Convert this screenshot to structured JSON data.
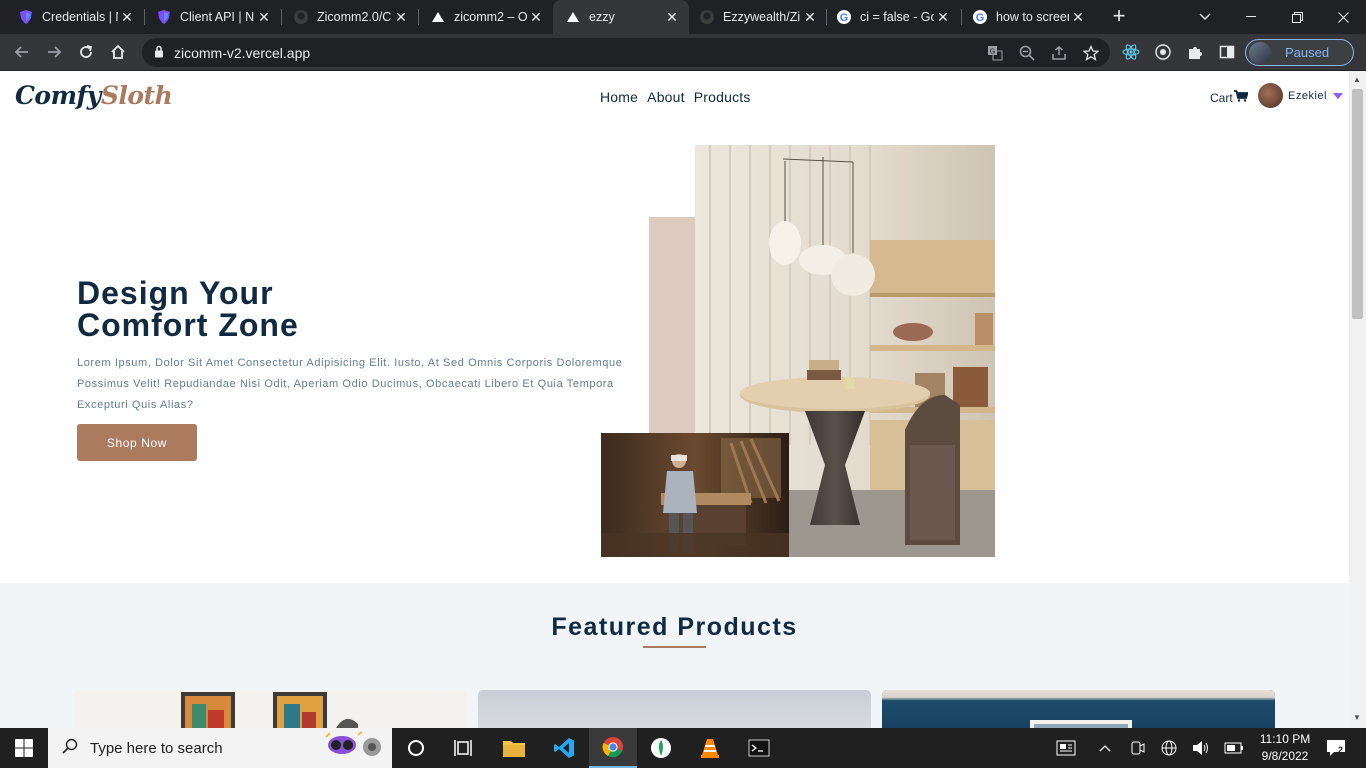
{
  "browser": {
    "tabs": [
      {
        "title": "Credentials | N",
        "icon": "shield-icon",
        "active": false
      },
      {
        "title": "Client API | N",
        "icon": "shield-icon",
        "active": false
      },
      {
        "title": "Zicomm2.0/C",
        "icon": "github-icon",
        "active": false
      },
      {
        "title": "zicomm2 – O",
        "icon": "vercel-icon",
        "active": false
      },
      {
        "title": "ezzy",
        "icon": "vercel-icon",
        "active": true
      },
      {
        "title": "Ezzywealth/Zi",
        "icon": "github-icon",
        "active": false
      },
      {
        "title": "ci = false - Go",
        "icon": "google-icon",
        "active": false
      },
      {
        "title": "how to screen",
        "icon": "google-icon",
        "active": false
      }
    ],
    "url": "zicomm-v2.vercel.app",
    "profile_status": "Paused"
  },
  "site": {
    "logo_part1": "Comfy",
    "logo_part2": "Sloth",
    "nav": [
      "Home",
      "About",
      "Products"
    ],
    "cart_label": "Cart",
    "user_name": "Ezekiel",
    "hero": {
      "title_line1": "Design Your",
      "title_line2": "Comfort Zone",
      "text": "Lorem Ipsum, Dolor Sit Amet Consectetur Adipisicing Elit. Iusto, At Sed Omnis Corporis Doloremque Possimus Velit! Repudiandae Nisi Odit, Aperiam Odio Ducimus, Obcaecati Libero Et Quia Tempora Excepturi Quis Alias?",
      "button": "Shop Now"
    },
    "featured_title": "Featured Products"
  },
  "colors": {
    "primary": "#ab7a5f",
    "dark_text": "#102a42",
    "muted_text": "#617d98",
    "featured_bg": "#f1f5f8"
  },
  "taskbar": {
    "search_placeholder": "Type here to search",
    "time": "11:10 PM",
    "date": "9/8/2022",
    "notification_count": "2"
  }
}
